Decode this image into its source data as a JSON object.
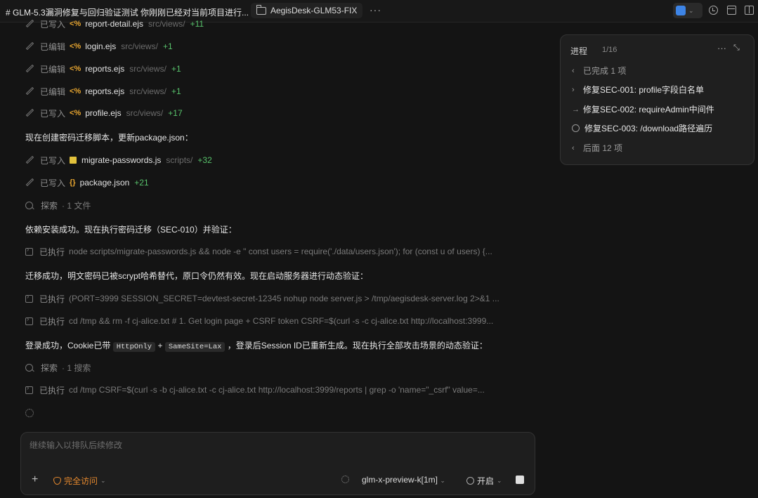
{
  "topbar": {
    "title": "# GLM-5.3漏洞修复与回归验证测试 你刚刚已经对当前项目进行...",
    "project_tab": "AegisDesk-GLM53-FIX",
    "more": "···"
  },
  "log": {
    "edits": [
      {
        "action": "已写入",
        "icon": "<%",
        "file": "report-detail.ejs",
        "path": "src/views/",
        "delta": "+11"
      },
      {
        "action": "已编辑",
        "icon": "<%",
        "file": "login.ejs",
        "path": "src/views/",
        "delta": "+1"
      },
      {
        "action": "已编辑",
        "icon": "<%",
        "file": "reports.ejs",
        "path": "src/views/",
        "delta": "+1"
      },
      {
        "action": "已编辑",
        "icon": "<%",
        "file": "reports.ejs",
        "path": "src/views/",
        "delta": "+1"
      },
      {
        "action": "已写入",
        "icon": "<%",
        "file": "profile.ejs",
        "path": "src/views/",
        "delta": "+17"
      }
    ],
    "msg1": "现在创建密码迁移脚本，更新package.json：",
    "edits2": [
      {
        "action": "已写入",
        "file": "migrate-passwords.js",
        "path": "scripts/",
        "delta": "+32"
      },
      {
        "action": "已写入",
        "icon": "{}",
        "file": "package.json",
        "delta": "+21"
      }
    ],
    "search1": {
      "action": "探索",
      "meta": "· 1 文件"
    },
    "msg2": "依赖安装成功。现在执行密码迁移（SEC-010）并验证：",
    "exec1": {
      "action": "已执行",
      "cmd": "node scripts/migrate-passwords.js && node -e \" const users = require('./data/users.json'); for (const u of users) {..."
    },
    "msg3": "迁移成功，明文密码已被scrypt哈希替代，原口令仍然有效。现在启动服务器进行动态验证：",
    "exec2": {
      "action": "已执行",
      "cmd": "(PORT=3999 SESSION_SECRET=devtest-secret-12345 nohup node server.js > /tmp/aegisdesk-server.log 2>&1 ..."
    },
    "exec3": {
      "action": "已执行",
      "cmd": "cd /tmp && rm -f cj-alice.txt # 1. Get login page + CSRF token CSRF=$(curl -s -c cj-alice.txt http://localhost:3999..."
    },
    "msg4": {
      "pre": "登录成功，Cookie已带",
      "code1": "HttpOnly",
      "plus": "+",
      "code2": "SameSite=Lax",
      "post": "，登录后Session ID已重新生成。现在执行全部攻击场景的动态验证："
    },
    "search2": {
      "action": "探索",
      "meta": "· 1 搜索"
    },
    "exec4": {
      "action": "已执行",
      "cmd": "cd /tmp CSRF=$(curl -s -b cj-alice.txt -c cj-alice.txt http://localhost:3999/reports | grep -o 'name=\"_csrf\" value=..."
    }
  },
  "progress": {
    "title": "进程",
    "count": "1/16",
    "done": "已完成 1 项",
    "tasks": [
      "修复SEC-001: profile字段白名单",
      "修复SEC-002: requireAdmin中间件",
      "修复SEC-003: /download路径遍历"
    ],
    "rest": "后面 12 项"
  },
  "composer": {
    "placeholder": "继续输入以排队后续修改",
    "access": "完全访问",
    "model": "glm-x-preview-k[1m]",
    "think": "开启"
  }
}
